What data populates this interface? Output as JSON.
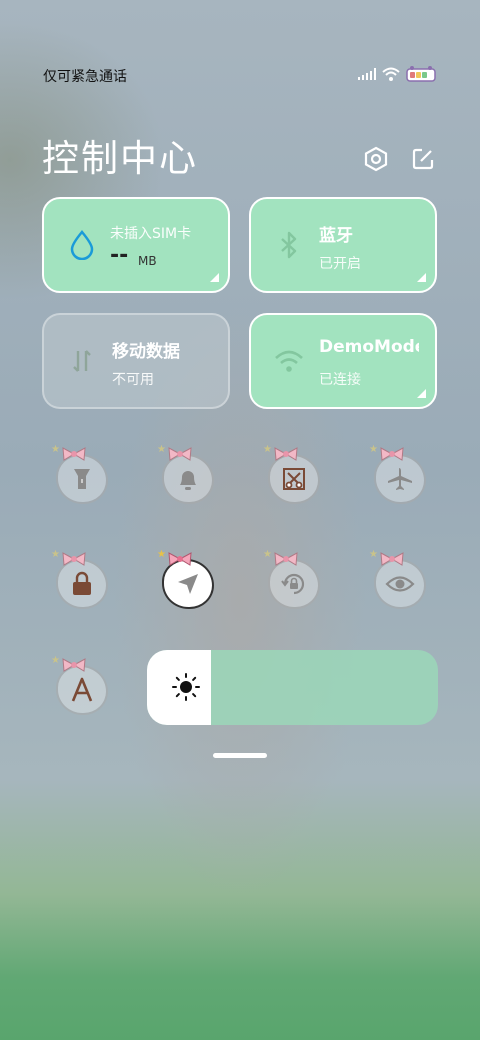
{
  "status_bar": {
    "carrier": "仅可紧急通话",
    "icons": [
      "signal-icon",
      "wifi-icon",
      "battery-icon"
    ]
  },
  "header": {
    "title": "控制中心",
    "settings_icon": "settings-icon",
    "edit_icon": "edit-icon"
  },
  "tiles": {
    "data_usage": {
      "label": "未插入SIM卡",
      "value": "--",
      "unit": "MB",
      "icon": "water-drop-icon"
    },
    "bluetooth": {
      "label": "蓝牙",
      "status": "已开启",
      "icon": "bluetooth-icon"
    },
    "mobile_data": {
      "label": "移动数据",
      "status": "不可用",
      "icon": "mobile-data-icon"
    },
    "wifi": {
      "label": "DemoMode",
      "status": "已连接",
      "icon": "wifi-icon"
    }
  },
  "quick_settings": [
    {
      "name": "flashlight",
      "icon": "flashlight-icon",
      "on": false
    },
    {
      "name": "silent",
      "icon": "bell-icon",
      "on": false
    },
    {
      "name": "screenshot",
      "icon": "scissors-icon",
      "on": false
    },
    {
      "name": "airplane",
      "icon": "airplane-icon",
      "on": false
    },
    {
      "name": "lock-screen",
      "icon": "lock-icon",
      "on": false
    },
    {
      "name": "location",
      "icon": "location-arrow-icon",
      "on": true
    },
    {
      "name": "auto-rotate",
      "icon": "rotate-lock-icon",
      "on": false
    },
    {
      "name": "eye-comfort",
      "icon": "eye-icon",
      "on": false
    },
    {
      "name": "auto-brightness",
      "icon": "font-a-icon",
      "on": false
    }
  ],
  "brightness": {
    "level": 0.22,
    "icon": "sun-icon"
  },
  "colors": {
    "accent": "#a2e3bf",
    "icon_brown": "#7a4a36",
    "inactive_icon": "#8a8a8a"
  }
}
